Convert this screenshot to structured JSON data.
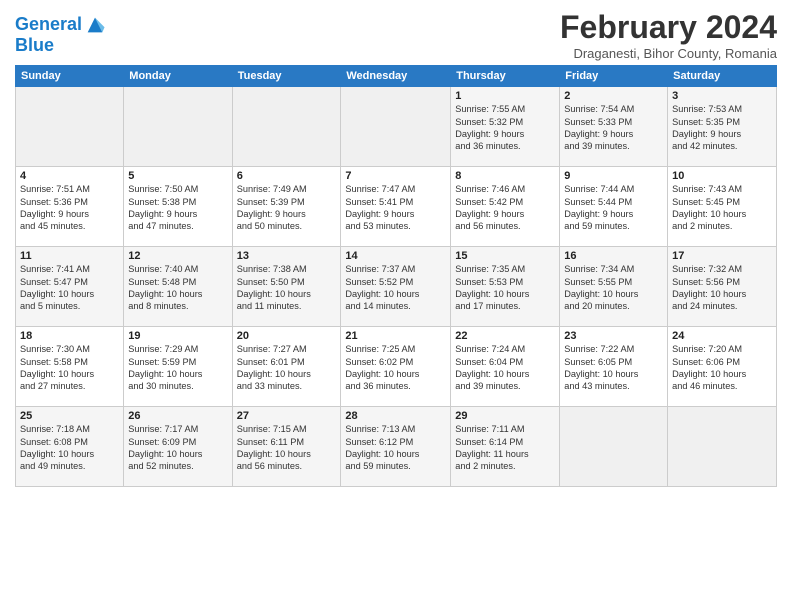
{
  "header": {
    "logo_line1": "General",
    "logo_line2": "Blue",
    "month": "February 2024",
    "location": "Draganesti, Bihor County, Romania"
  },
  "weekdays": [
    "Sunday",
    "Monday",
    "Tuesday",
    "Wednesday",
    "Thursday",
    "Friday",
    "Saturday"
  ],
  "weeks": [
    [
      {
        "num": "",
        "info": ""
      },
      {
        "num": "",
        "info": ""
      },
      {
        "num": "",
        "info": ""
      },
      {
        "num": "",
        "info": ""
      },
      {
        "num": "1",
        "info": "Sunrise: 7:55 AM\nSunset: 5:32 PM\nDaylight: 9 hours\nand 36 minutes."
      },
      {
        "num": "2",
        "info": "Sunrise: 7:54 AM\nSunset: 5:33 PM\nDaylight: 9 hours\nand 39 minutes."
      },
      {
        "num": "3",
        "info": "Sunrise: 7:53 AM\nSunset: 5:35 PM\nDaylight: 9 hours\nand 42 minutes."
      }
    ],
    [
      {
        "num": "4",
        "info": "Sunrise: 7:51 AM\nSunset: 5:36 PM\nDaylight: 9 hours\nand 45 minutes."
      },
      {
        "num": "5",
        "info": "Sunrise: 7:50 AM\nSunset: 5:38 PM\nDaylight: 9 hours\nand 47 minutes."
      },
      {
        "num": "6",
        "info": "Sunrise: 7:49 AM\nSunset: 5:39 PM\nDaylight: 9 hours\nand 50 minutes."
      },
      {
        "num": "7",
        "info": "Sunrise: 7:47 AM\nSunset: 5:41 PM\nDaylight: 9 hours\nand 53 minutes."
      },
      {
        "num": "8",
        "info": "Sunrise: 7:46 AM\nSunset: 5:42 PM\nDaylight: 9 hours\nand 56 minutes."
      },
      {
        "num": "9",
        "info": "Sunrise: 7:44 AM\nSunset: 5:44 PM\nDaylight: 9 hours\nand 59 minutes."
      },
      {
        "num": "10",
        "info": "Sunrise: 7:43 AM\nSunset: 5:45 PM\nDaylight: 10 hours\nand 2 minutes."
      }
    ],
    [
      {
        "num": "11",
        "info": "Sunrise: 7:41 AM\nSunset: 5:47 PM\nDaylight: 10 hours\nand 5 minutes."
      },
      {
        "num": "12",
        "info": "Sunrise: 7:40 AM\nSunset: 5:48 PM\nDaylight: 10 hours\nand 8 minutes."
      },
      {
        "num": "13",
        "info": "Sunrise: 7:38 AM\nSunset: 5:50 PM\nDaylight: 10 hours\nand 11 minutes."
      },
      {
        "num": "14",
        "info": "Sunrise: 7:37 AM\nSunset: 5:52 PM\nDaylight: 10 hours\nand 14 minutes."
      },
      {
        "num": "15",
        "info": "Sunrise: 7:35 AM\nSunset: 5:53 PM\nDaylight: 10 hours\nand 17 minutes."
      },
      {
        "num": "16",
        "info": "Sunrise: 7:34 AM\nSunset: 5:55 PM\nDaylight: 10 hours\nand 20 minutes."
      },
      {
        "num": "17",
        "info": "Sunrise: 7:32 AM\nSunset: 5:56 PM\nDaylight: 10 hours\nand 24 minutes."
      }
    ],
    [
      {
        "num": "18",
        "info": "Sunrise: 7:30 AM\nSunset: 5:58 PM\nDaylight: 10 hours\nand 27 minutes."
      },
      {
        "num": "19",
        "info": "Sunrise: 7:29 AM\nSunset: 5:59 PM\nDaylight: 10 hours\nand 30 minutes."
      },
      {
        "num": "20",
        "info": "Sunrise: 7:27 AM\nSunset: 6:01 PM\nDaylight: 10 hours\nand 33 minutes."
      },
      {
        "num": "21",
        "info": "Sunrise: 7:25 AM\nSunset: 6:02 PM\nDaylight: 10 hours\nand 36 minutes."
      },
      {
        "num": "22",
        "info": "Sunrise: 7:24 AM\nSunset: 6:04 PM\nDaylight: 10 hours\nand 39 minutes."
      },
      {
        "num": "23",
        "info": "Sunrise: 7:22 AM\nSunset: 6:05 PM\nDaylight: 10 hours\nand 43 minutes."
      },
      {
        "num": "24",
        "info": "Sunrise: 7:20 AM\nSunset: 6:06 PM\nDaylight: 10 hours\nand 46 minutes."
      }
    ],
    [
      {
        "num": "25",
        "info": "Sunrise: 7:18 AM\nSunset: 6:08 PM\nDaylight: 10 hours\nand 49 minutes."
      },
      {
        "num": "26",
        "info": "Sunrise: 7:17 AM\nSunset: 6:09 PM\nDaylight: 10 hours\nand 52 minutes."
      },
      {
        "num": "27",
        "info": "Sunrise: 7:15 AM\nSunset: 6:11 PM\nDaylight: 10 hours\nand 56 minutes."
      },
      {
        "num": "28",
        "info": "Sunrise: 7:13 AM\nSunset: 6:12 PM\nDaylight: 10 hours\nand 59 minutes."
      },
      {
        "num": "29",
        "info": "Sunrise: 7:11 AM\nSunset: 6:14 PM\nDaylight: 11 hours\nand 2 minutes."
      },
      {
        "num": "",
        "info": ""
      },
      {
        "num": "",
        "info": ""
      }
    ]
  ]
}
